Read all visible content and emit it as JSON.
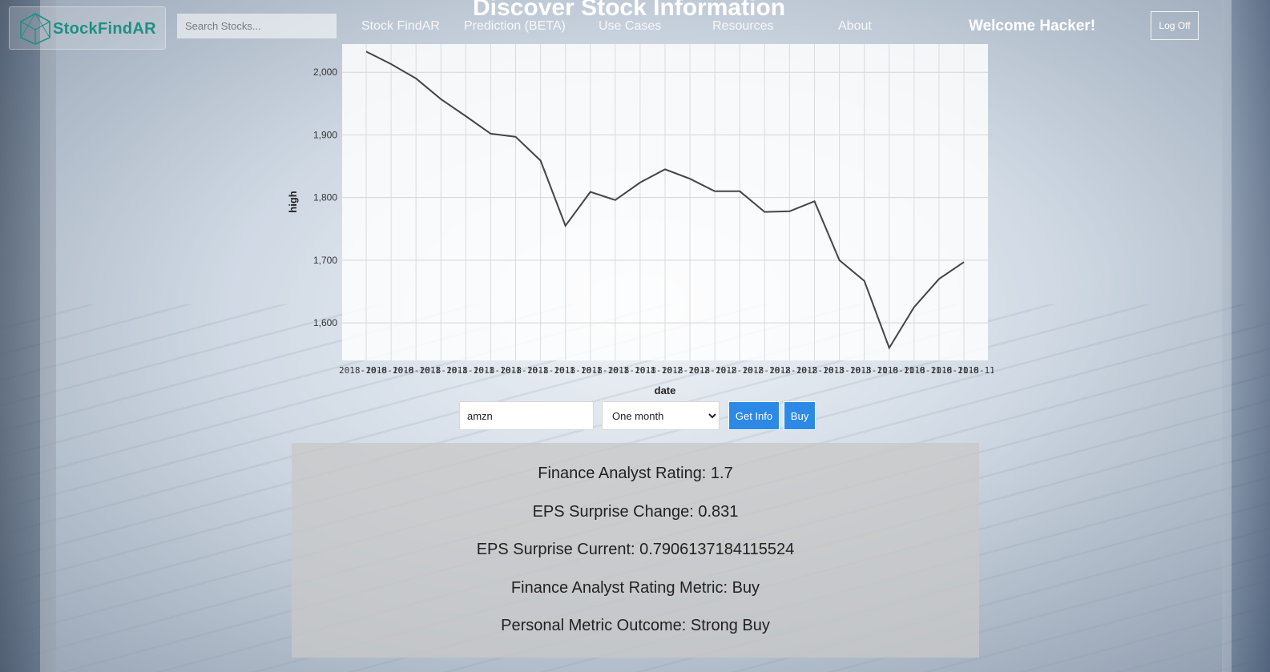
{
  "header": {
    "brand": "StockFindAR",
    "search_placeholder": "Search Stocks...",
    "page_title": "Discover Stock Information",
    "nav": [
      "Stock FindAR",
      "Prediction (BETA)",
      "Use Cases",
      "Resources",
      "About"
    ],
    "welcome": "Welcome Hacker!",
    "logoff_label": "Log Off"
  },
  "chart_data": {
    "type": "line",
    "xlabel": "date",
    "ylabel": "high",
    "ylim": [
      1540,
      2045
    ],
    "y_ticks": [
      1600,
      1700,
      1800,
      1900,
      2000
    ],
    "y_tick_labels": [
      "1,600",
      "1,700",
      "1,800",
      "1,900",
      "2,000"
    ],
    "x_tick_labels": [
      "2018-10-0",
      "2018-10-0",
      "2018-10-1",
      "2018-10-1",
      "2018-10-1",
      "2018-10-1",
      "2018-10-1",
      "2018-10-1",
      "2018-10-1",
      "2018-10-1",
      "2018-10-1",
      "2018-10-2",
      "2018-10-2",
      "2018-10-2",
      "2018-10-2",
      "2018-10-2",
      "2018-10-2",
      "2018-10-3",
      "2018-10-3",
      "2018-11-0",
      "2018-11-0",
      "2018-11-0",
      "2018-11-0",
      "2018-11-0"
    ],
    "grid": true,
    "values": [
      2033,
      2013,
      1990,
      1957,
      1930,
      1902,
      1897,
      1859,
      1755,
      1809,
      1796,
      1824,
      1845,
      1830,
      1810,
      1810,
      1777,
      1778,
      1794,
      1700,
      1667,
      1560,
      1625,
      1670,
      1697
    ]
  },
  "controls": {
    "ticker_value": "amzn",
    "range_selected": "One month",
    "get_info_label": "Get Info",
    "buy_label": "Buy"
  },
  "info": {
    "lines": [
      "Finance Analyst Rating: 1.7",
      "EPS Surprise Change: 0.831",
      "EPS Surprise Current: 0.7906137184115524",
      "Finance Analyst Rating Metric: Buy",
      "Personal Metric Outcome: Strong Buy"
    ]
  },
  "colors": {
    "brand": "#1e8f84",
    "button_blue": "#2c8ae6",
    "line": "#444444"
  }
}
